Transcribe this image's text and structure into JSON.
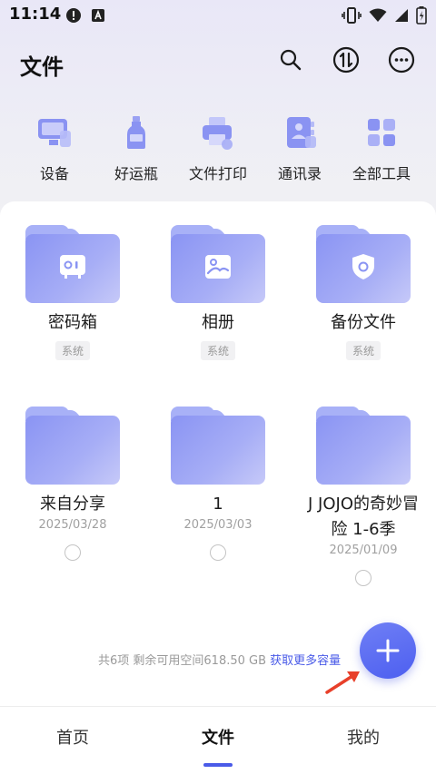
{
  "status_bar": {
    "time": "11:14"
  },
  "header": {
    "title": "文件"
  },
  "tools": [
    {
      "label": "设备",
      "icon": "device-icon"
    },
    {
      "label": "好运瓶",
      "icon": "bottle-icon"
    },
    {
      "label": "文件打印",
      "icon": "printer-icon"
    },
    {
      "label": "通讯录",
      "icon": "contacts-icon"
    },
    {
      "label": "全部工具",
      "icon": "grid-icon"
    }
  ],
  "folders": [
    {
      "name": "密码箱",
      "badge": "系统",
      "icon": "safe-icon"
    },
    {
      "name": "相册",
      "badge": "系统",
      "icon": "album-icon"
    },
    {
      "name": "备份文件",
      "badge": "系统",
      "icon": "shield-icon"
    },
    {
      "name": "来自分享",
      "date": "2025/03/28"
    },
    {
      "name": "1",
      "date": "2025/03/03"
    },
    {
      "name": "J JOJO的奇妙冒险 1-6季",
      "date": "2025/01/09"
    }
  ],
  "storage": {
    "summary": "共6项 剩余可用空间618.50 GB",
    "link": "获取更多容量"
  },
  "bottom_nav": {
    "items": [
      {
        "label": "首页"
      },
      {
        "label": "文件"
      },
      {
        "label": "我的"
      }
    ],
    "active": "文件"
  },
  "colors": {
    "accent": "#4a5be8",
    "folder": "#9aa3f5",
    "fab": "#5a6bf2",
    "arrow": "#e8402a"
  }
}
